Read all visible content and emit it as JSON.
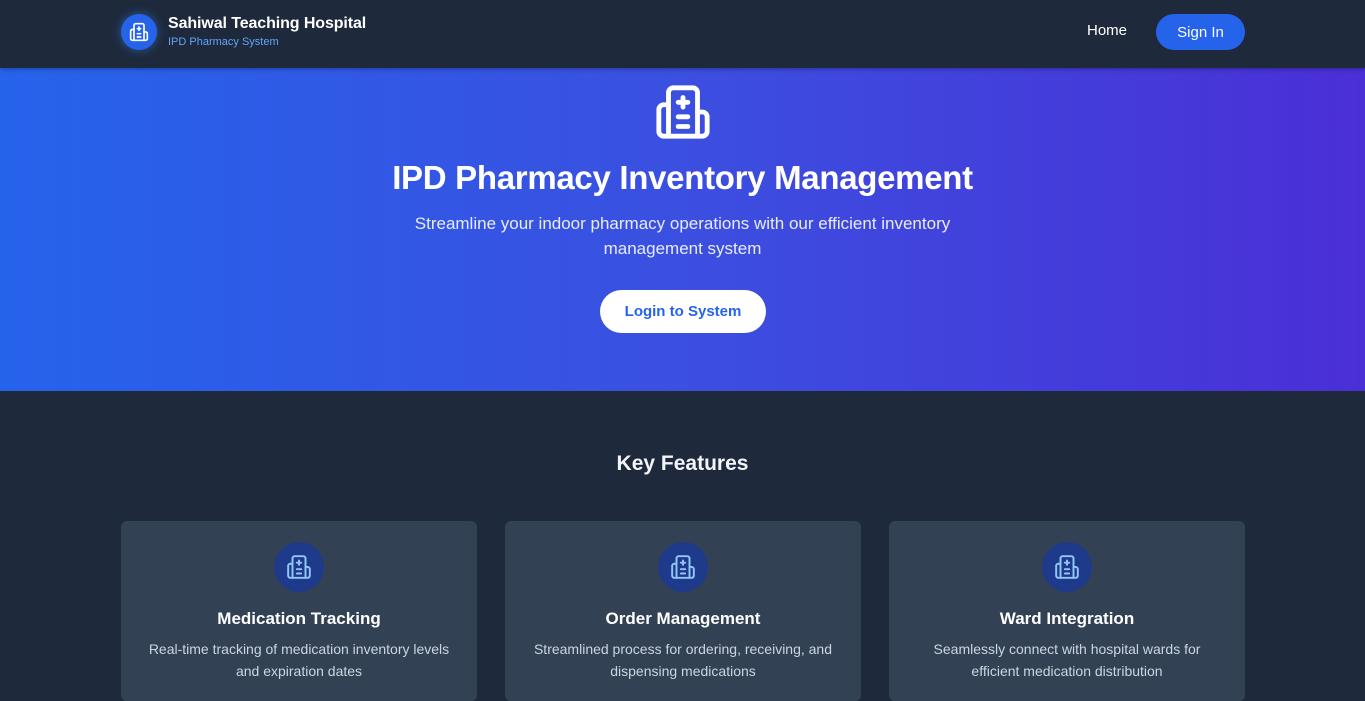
{
  "navbar": {
    "brand_title": "Sahiwal Teaching Hospital",
    "brand_subtitle": "IPD Pharmacy System",
    "brand_icon": "hospital-icon",
    "home_label": "Home",
    "signin_label": "Sign In"
  },
  "hero": {
    "icon": "hospital-icon",
    "title": "IPD Pharmacy Inventory Management",
    "subtitle": "Streamline your indoor pharmacy operations with our efficient inventory management system",
    "cta_label": "Login to System"
  },
  "features": {
    "title": "Key Features",
    "cards": [
      {
        "icon": "hospital-icon",
        "title": "Medication Tracking",
        "description": "Real-time tracking of medication inventory levels and expiration dates"
      },
      {
        "icon": "hospital-icon",
        "title": "Order Management",
        "description": "Streamlined process for ordering, receiving, and dispensing medications"
      },
      {
        "icon": "hospital-icon",
        "title": "Ward Integration",
        "description": "Seamlessly connect with hospital wards for efficient medication distribution"
      }
    ]
  },
  "colors": {
    "navbar_bg": "#1e293b",
    "accent": "#2563eb",
    "hero_gradient_start": "#2563eb",
    "hero_gradient_end": "#4a2fd6",
    "card_bg": "#334155",
    "card_icon_bg": "#1e3a8a",
    "subtitle_link": "#60a5fa"
  }
}
